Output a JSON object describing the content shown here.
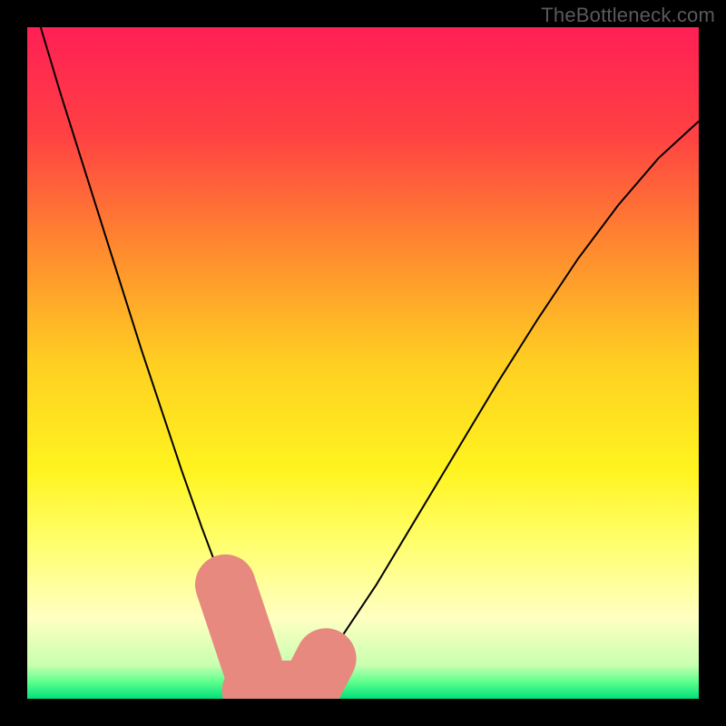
{
  "watermark": "TheBottleneck.com",
  "chart_data": {
    "type": "line",
    "title": "",
    "xlabel": "",
    "ylabel": "",
    "xlim": [
      0,
      100
    ],
    "ylim": [
      0,
      100
    ],
    "background": {
      "type": "vertical-gradient",
      "stops": [
        {
          "offset": 0.0,
          "color": "#ff1f55"
        },
        {
          "offset": 0.16,
          "color": "#ff4143"
        },
        {
          "offset": 0.33,
          "color": "#ff8a2f"
        },
        {
          "offset": 0.5,
          "color": "#ffcf22"
        },
        {
          "offset": 0.66,
          "color": "#fff41f"
        },
        {
          "offset": 0.77,
          "color": "#ffff6f"
        },
        {
          "offset": 0.88,
          "color": "#ffffc2"
        },
        {
          "offset": 0.95,
          "color": "#c9ffb0"
        },
        {
          "offset": 0.975,
          "color": "#5dff8d"
        },
        {
          "offset": 1.0,
          "color": "#00e07a"
        }
      ]
    },
    "series": [
      {
        "name": "bottleneck-curve",
        "color": "#000000",
        "width": 2,
        "x": [
          2,
          5,
          8,
          11,
          14,
          17,
          20,
          23,
          26,
          29,
          31,
          33,
          34.5,
          36,
          38,
          41,
          46,
          52,
          58,
          64,
          70,
          76,
          82,
          88,
          94,
          100
        ],
        "y": [
          100,
          90,
          80.5,
          71,
          61.5,
          52,
          43,
          34,
          25.5,
          17.5,
          11,
          6,
          2.5,
          0.5,
          0.5,
          2.5,
          8,
          17,
          27,
          37,
          47,
          56.5,
          65.5,
          73.5,
          80.5,
          86
        ]
      }
    ],
    "overlays": [
      {
        "name": "highlight-left",
        "type": "rounded-bar",
        "color": "#e8897f",
        "radius": 4.5,
        "x1": 29.5,
        "y1": 17,
        "x2": 33.5,
        "y2": 5
      },
      {
        "name": "highlight-bottom",
        "type": "rounded-bar",
        "color": "#e8897f",
        "radius": 4.5,
        "x1": 33.5,
        "y1": 1.2,
        "x2": 42,
        "y2": 1.2
      },
      {
        "name": "highlight-right",
        "type": "rounded-bar",
        "color": "#e8897f",
        "radius": 4.5,
        "x1": 42,
        "y1": 1.2,
        "x2": 44.5,
        "y2": 6
      }
    ]
  }
}
